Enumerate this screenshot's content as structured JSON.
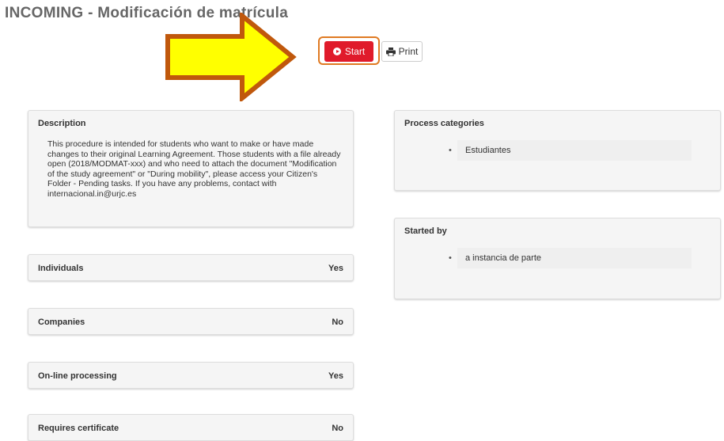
{
  "page": {
    "title": "INCOMING - Modificación de matrícula"
  },
  "toolbar": {
    "start_label": "Start",
    "print_label": "Print"
  },
  "description": {
    "heading": "Description",
    "text": "This procedure is intended for students who want to make or have made changes to their original Learning Agreement. Those students with a file already open (2018/MODMAT-xxx) and who need to attach the document \"Modification of the study agreement\" or \"During mobility\", please access your Citizen's Folder - Pending tasks. If you have any problems, contact with internacional.in@urjc.es"
  },
  "attributes": [
    {
      "label": "Individuals",
      "value": "Yes"
    },
    {
      "label": "Companies",
      "value": "No"
    },
    {
      "label": "On-line processing",
      "value": "Yes"
    },
    {
      "label": "Requires certificate",
      "value": "No"
    }
  ],
  "process_categories": {
    "heading": "Process categories",
    "items": [
      "Estudiantes"
    ]
  },
  "started_by": {
    "heading": "Started by",
    "items": [
      "a instancia de parte"
    ]
  },
  "colors": {
    "start_button": "#e01b2b",
    "highlight_border": "#e07a22",
    "arrow_fill": "#ffff00",
    "arrow_stroke": "#c0580c"
  },
  "icons": {
    "start": "play-circle-icon",
    "print": "printer-icon",
    "annotation": "right-arrow-annotation"
  }
}
